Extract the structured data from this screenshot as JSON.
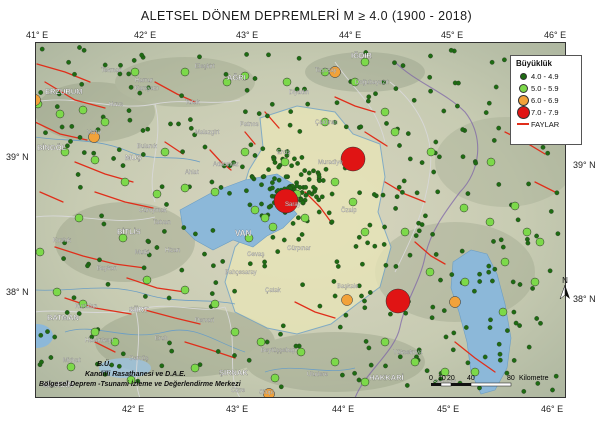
{
  "title": "ALETSEL DÖNEM DEPREMLERİ M ≥ 4.0  (1900 - 2018)",
  "lon_ticks": [
    "41° E",
    "42° E",
    "43° E",
    "44° E",
    "45° E",
    "46° E"
  ],
  "lat_ticks": [
    "39° N",
    "38° N"
  ],
  "legend": {
    "title": "Büyüklük",
    "items": [
      {
        "label": "4.0 - 4.9",
        "color": "#1e6b12"
      },
      {
        "label": "5.0 - 5.9",
        "color": "#7cd94a"
      },
      {
        "label": "6.0 - 6.9",
        "color": "#f2a23a"
      },
      {
        "label": "7.0 - 7.9",
        "color": "#e01414"
      }
    ],
    "faults_label": "FAYLAR",
    "fault_color": "#e02e1a"
  },
  "place_names": [
    "ERZURUM",
    "BİNGÖL",
    "MUŞ",
    "BİTLİS",
    "BATMAN",
    "SİİRT",
    "MARDİN",
    "ŞIRNAK",
    "VAN",
    "HAKKARİ",
    "AĞRI",
    "IĞDIR",
    "Patnos",
    "Erciş",
    "Muradiye",
    "Doğubayazıt",
    "Tatvan",
    "Gevaş",
    "Gürpınar",
    "Başkale",
    "Çaldıran",
    "Özalp",
    "Saray",
    "Yüksekova",
    "Şemdinli",
    "Ahlat",
    "Adilcevaz",
    "Malazgirt",
    "Bulanık",
    "Varto",
    "Hınıs",
    "Tekman",
    "Karayazı",
    "Eleşkirt",
    "Taşlıçay",
    "Diyadin",
    "Tutak",
    "Hamur",
    "Kurtalan",
    "Baykan",
    "Hizan",
    "Mutki",
    "Güroymak",
    "Pervari",
    "Eruh",
    "Cizre",
    "Uludere",
    "Beytüşşebap",
    "Çatak",
    "Bahçesaray",
    "Kozluk",
    "Hasankeyf",
    "Midyat",
    "Gercüş",
    "Silopi"
  ],
  "north_label": "N",
  "scale": {
    "ticks": [
      "0",
      "10",
      "20",
      "40",
      "80"
    ],
    "unit": "Kilometre"
  },
  "credits": [
    "B.Ü.",
    "Kandilli Rasathanesi ve D.A.E.",
    "Bölgesel Deprem -Tsunami İzleme ve Değerlendirme Merkezi"
  ]
}
